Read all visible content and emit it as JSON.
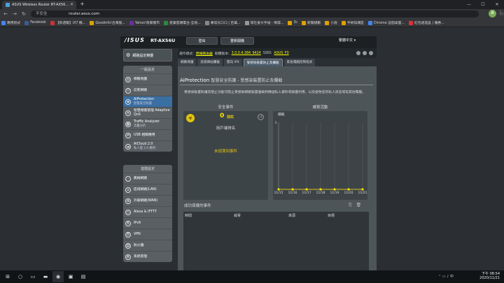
{
  "browser": {
    "tab_title": "ASUS Wireless Router RT-AX56...",
    "secure_label": "不安全",
    "url": "router.asus.com",
    "bookmarks": [
      {
        "label": "應用程式",
        "color": "#4285f4"
      },
      {
        "label": "Facebook",
        "color": "#3b5998"
      },
      {
        "label": "【新週報】iX7 機...",
        "color": "#c33"
      },
      {
        "label": "Goodinfo!台灣股...",
        "color": "#d8a400"
      },
      {
        "label": "Yahoo!奇摩服市",
        "color": "#6b2ea1"
      },
      {
        "label": "產業雲端電台-全培...",
        "color": "#2b8a3e"
      },
      {
        "label": "專寫天口口 | 百萬...",
        "color": "#888"
      },
      {
        "label": "等社會大手福 - 飛得...",
        "color": "#999"
      },
      {
        "label": "3c",
        "color": "#e0a000"
      },
      {
        "label": "新聞規劃",
        "color": "#e0a000"
      },
      {
        "label": "小說",
        "color": "#e0a000"
      },
      {
        "label": "手術知識區",
        "color": "#e0a000"
      },
      {
        "label": "Chrome 這個桌面...",
        "color": "#4285f4"
      },
      {
        "label": "紅包透過盒 | 優惠...",
        "color": "#d33"
      }
    ]
  },
  "router": {
    "brand": "/ISUS",
    "model": "RT-AX56U",
    "logout_label": "登出",
    "reboot_label": "重新開機",
    "language": "繁體中文",
    "op_mode_label": "運作模式:",
    "op_mode_value": "無線路由器",
    "firmware_label": "韌體版本:",
    "firmware_value": "3.0.0.4.384_9424",
    "ssid_label": "SSID:",
    "ssid_value": "ASUS_F0",
    "qis_label": "網路設定精靈",
    "general_title": "一般設定",
    "general_items": [
      {
        "label": "網路地圖",
        "sub": "",
        "icon": "network-map-icon",
        "glyph": "◎"
      },
      {
        "label": "訪客網路",
        "sub": "",
        "icon": "guest-network-icon",
        "glyph": "⚇"
      },
      {
        "label": "AiProtection",
        "sub": "智慧安全防護",
        "icon": "shield-icon",
        "glyph": "◈"
      },
      {
        "label": "智慧頻寬管理 Adaptive QoS",
        "sub": "",
        "icon": "qos-icon",
        "glyph": "≡"
      },
      {
        "label": "Traffic Analyzer",
        "sub": "流量分析",
        "icon": "traffic-analyzer-icon",
        "glyph": "▦"
      },
      {
        "label": "USB 相關應用",
        "sub": "",
        "icon": "usb-icon",
        "glyph": "⇌"
      },
      {
        "label": "AiCloud 2.0",
        "sub": "私人雲 2.0 應用",
        "icon": "cloud-icon",
        "glyph": "☁"
      }
    ],
    "advanced_title": "進階設定",
    "advanced_items": [
      {
        "label": "無線網路",
        "icon": "wireless-icon",
        "glyph": "((·))"
      },
      {
        "label": "區域網路(LAN)",
        "icon": "lan-icon",
        "glyph": "⌂"
      },
      {
        "label": "外部網路(WAN)",
        "icon": "wan-icon",
        "glyph": "⊕"
      },
      {
        "label": "Alexa & IFTTT",
        "icon": "alexa-icon",
        "glyph": "○"
      },
      {
        "label": "IPv6",
        "icon": "ipv6-icon",
        "glyph": "6"
      },
      {
        "label": "VPN",
        "icon": "vpn-icon",
        "glyph": "⚿"
      },
      {
        "label": "防火牆",
        "icon": "firewall-icon",
        "glyph": "▤"
      },
      {
        "label": "系統管理",
        "icon": "admin-icon",
        "glyph": "⚙"
      }
    ],
    "tabs": [
      "網路保護",
      "惡意網站攔截",
      "雙向 IPS",
      "受感染裝置防止及攔截",
      "家長電腦控制程式"
    ],
    "selected_tab": 3,
    "main_title": "AiProtection",
    "main_subtitle": "智慧安全防護 - 受感染裝置防止及攔截",
    "description": "受感染裝置防護及阻止功能可阻止受感染網路裝置連線到傳送私人資料或檢獲利用，以及避免您的私人訊息或寫其他電腦。",
    "security_events_title": "安全事件",
    "security_count": "0",
    "security_count_unit": "攔截",
    "rank_label": "用戶端排名",
    "no_events": "未偵測到事件",
    "activity_title": "威脅活動",
    "events_list_title": "成功保護的事件",
    "table_headers": [
      "時間",
      "威脅",
      "來源",
      "目標"
    ]
  },
  "chart_data": {
    "type": "line",
    "title": "威脅活動",
    "ylabel": "攔截",
    "x": [
      "11/15",
      "11/16",
      "11/17",
      "11/18",
      "11/19",
      "11/20",
      "11/21"
    ],
    "series": [
      {
        "values": [
          0,
          0,
          0,
          0,
          0,
          0,
          0
        ]
      }
    ],
    "ylim": [
      0,
      1
    ],
    "yticks": [
      1
    ],
    "grid": true,
    "marker_color": "#ffe100"
  },
  "taskbar": {
    "time": "下午 08:54",
    "date": "2020/11/21"
  }
}
